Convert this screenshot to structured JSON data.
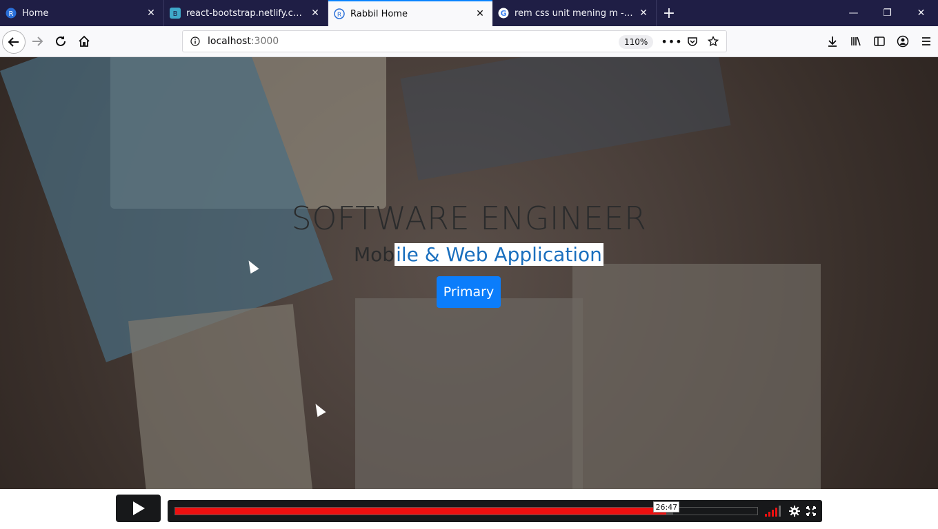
{
  "tabs": [
    {
      "title": "Home",
      "icon": "rabbil-favicon-icon",
      "active": false
    },
    {
      "title": "react-bootstrap.netlify.com/com",
      "icon": "bootstrap-favicon-icon",
      "active": false
    },
    {
      "title": "Rabbil Home",
      "icon": "rabbil-favicon-icon",
      "active": true
    },
    {
      "title": "rem css unit mening m - Google",
      "icon": "google-favicon-icon",
      "active": false
    }
  ],
  "navbar": {
    "url_host": "localhost",
    "url_port": ":3000",
    "zoom": "110%"
  },
  "hero": {
    "title": "SOFTWARE ENGINEER",
    "subtitle_pre": "Mob",
    "subtitle_selected": "ile & Web Application",
    "button_label": "Primary"
  },
  "video": {
    "timecode": "26:47",
    "progress_fraction": 0.844,
    "buffered_fraction": 0.855,
    "volume_bars_on": 4,
    "volume_bars_total": 5
  },
  "colors": {
    "tabstrip": "#1f1e45",
    "accent": "#0a84ff",
    "primary_button": "#0b7dfb",
    "progress": "#ee1010"
  }
}
